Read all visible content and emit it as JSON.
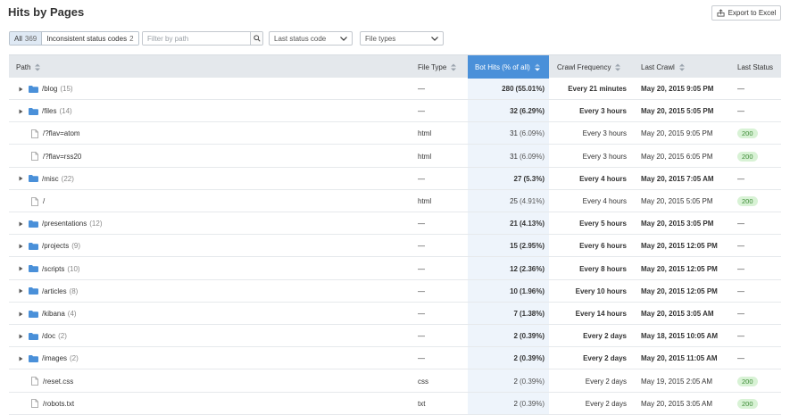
{
  "header": {
    "title": "Hits by Pages",
    "export_label": "Export to Excel"
  },
  "filters": {
    "all_label": "All",
    "all_count": "369",
    "inconsistent_label": "Inconsistent status codes",
    "inconsistent_count": "2",
    "search_placeholder": "Filter by path",
    "status_dropdown": "Last status code",
    "filetype_dropdown": "File types"
  },
  "columns": {
    "path": "Path",
    "file_type": "File Type",
    "bot_hits": "Bot Hits (% of all)",
    "crawl_frequency": "Crawl Frequency",
    "last_crawl": "Last Crawl",
    "last_status": "Last Status"
  },
  "colors": {
    "accent": "#4a90d9",
    "folder": "#4a90d9",
    "badge_bg": "#d8f2d5",
    "badge_text": "#3d8b36"
  },
  "rows": [
    {
      "kind": "folder",
      "path": "/blog",
      "count": "(15)",
      "type": "—",
      "hits": "280",
      "pct": "(55.01%)",
      "freq": "Every 21 minutes",
      "crawl": "May 20, 2015 9:05 PM",
      "status": "—"
    },
    {
      "kind": "folder",
      "path": "/files",
      "count": "(14)",
      "type": "—",
      "hits": "32",
      "pct": "(6.29%)",
      "freq": "Every 3 hours",
      "crawl": "May 20, 2015 5:05 PM",
      "status": "—"
    },
    {
      "kind": "file",
      "path": "/?flav=atom",
      "count": "",
      "type": "html",
      "hits": "31",
      "pct": "(6.09%)",
      "freq": "Every 3 hours",
      "crawl": "May 20, 2015 9:05 PM",
      "status": "200"
    },
    {
      "kind": "file",
      "path": "/?flav=rss20",
      "count": "",
      "type": "html",
      "hits": "31",
      "pct": "(6.09%)",
      "freq": "Every 3 hours",
      "crawl": "May 20, 2015 6:05 PM",
      "status": "200"
    },
    {
      "kind": "folder",
      "path": "/misc",
      "count": "(22)",
      "type": "—",
      "hits": "27",
      "pct": "(5.3%)",
      "freq": "Every 4 hours",
      "crawl": "May 20, 2015 7:05 AM",
      "status": "—"
    },
    {
      "kind": "file",
      "path": "/",
      "count": "",
      "type": "html",
      "hits": "25",
      "pct": "(4.91%)",
      "freq": "Every 4 hours",
      "crawl": "May 20, 2015 5:05 PM",
      "status": "200"
    },
    {
      "kind": "folder",
      "path": "/presentations",
      "count": "(12)",
      "type": "—",
      "hits": "21",
      "pct": "(4.13%)",
      "freq": "Every 5 hours",
      "crawl": "May 20, 2015 3:05 PM",
      "status": "—"
    },
    {
      "kind": "folder",
      "path": "/projects",
      "count": "(9)",
      "type": "—",
      "hits": "15",
      "pct": "(2.95%)",
      "freq": "Every 6 hours",
      "crawl": "May 20, 2015 12:05 PM",
      "status": "—"
    },
    {
      "kind": "folder",
      "path": "/scripts",
      "count": "(10)",
      "type": "—",
      "hits": "12",
      "pct": "(2.36%)",
      "freq": "Every 8 hours",
      "crawl": "May 20, 2015 12:05 PM",
      "status": "—"
    },
    {
      "kind": "folder",
      "path": "/articles",
      "count": "(8)",
      "type": "—",
      "hits": "10",
      "pct": "(1.96%)",
      "freq": "Every 10 hours",
      "crawl": "May 20, 2015 12:05 PM",
      "status": "—"
    },
    {
      "kind": "folder",
      "path": "/kibana",
      "count": "(4)",
      "type": "—",
      "hits": "7",
      "pct": "(1.38%)",
      "freq": "Every 14 hours",
      "crawl": "May 20, 2015 3:05 AM",
      "status": "—"
    },
    {
      "kind": "folder",
      "path": "/doc",
      "count": "(2)",
      "type": "—",
      "hits": "2",
      "pct": "(0.39%)",
      "freq": "Every 2 days",
      "crawl": "May 18, 2015 10:05 AM",
      "status": "—"
    },
    {
      "kind": "folder",
      "path": "/images",
      "count": "(2)",
      "type": "—",
      "hits": "2",
      "pct": "(0.39%)",
      "freq": "Every 2 days",
      "crawl": "May 20, 2015 11:05 AM",
      "status": "—"
    },
    {
      "kind": "file",
      "path": "/reset.css",
      "count": "",
      "type": "css",
      "hits": "2",
      "pct": "(0.39%)",
      "freq": "Every 2 days",
      "crawl": "May 19, 2015 2:05 AM",
      "status": "200"
    },
    {
      "kind": "file",
      "path": "/robots.txt",
      "count": "",
      "type": "txt",
      "hits": "2",
      "pct": "(0.39%)",
      "freq": "Every 2 days",
      "crawl": "May 20, 2015 3:05 AM",
      "status": "200"
    }
  ]
}
